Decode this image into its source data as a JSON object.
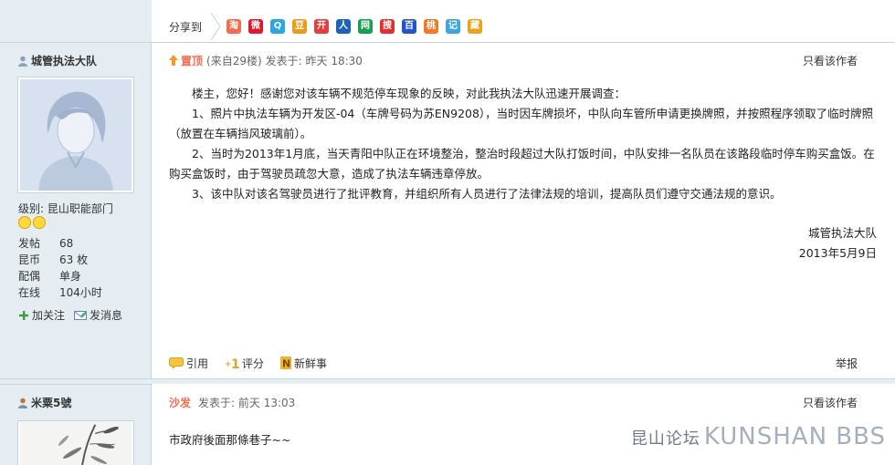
{
  "share": {
    "label": "分享到",
    "icons": [
      {
        "name": "qzone-icon",
        "glyph": "淘",
        "color": "#f26c4f"
      },
      {
        "name": "weibo-icon",
        "glyph": "微",
        "color": "#e6162d"
      },
      {
        "name": "qq-icon",
        "glyph": "Q",
        "color": "#2ba5e4"
      },
      {
        "name": "douban-icon",
        "glyph": "豆",
        "color": "#e89d1a"
      },
      {
        "name": "kaixin-icon",
        "glyph": "开",
        "color": "#e23f3f"
      },
      {
        "name": "renren-icon",
        "glyph": "人",
        "color": "#1e63b8"
      },
      {
        "name": "netease-icon",
        "glyph": "网",
        "color": "#1a9f4f"
      },
      {
        "name": "sohu-icon",
        "glyph": "搜",
        "color": "#e23030"
      },
      {
        "name": "baidu-icon",
        "glyph": "百",
        "color": "#2252cc"
      },
      {
        "name": "peach-icon",
        "glyph": "桃",
        "color": "#f07a2c"
      },
      {
        "name": "note-icon",
        "glyph": "记",
        "color": "#3ea6d8"
      },
      {
        "name": "bookmark-icon",
        "glyph": "藏",
        "color": "#e8a31a"
      }
    ]
  },
  "post1": {
    "author": "城管执法大队",
    "level": "级别: 昆山职能部门",
    "stats": [
      {
        "k": "发帖",
        "v": "68"
      },
      {
        "k": "昆币",
        "v": "63 枚"
      },
      {
        "k": "配偶",
        "v": "单身"
      },
      {
        "k": "在线",
        "v": "104小时"
      }
    ],
    "follow": "加关注",
    "message": "发消息",
    "pin": "置顶",
    "from_floor": "(来自29楼)",
    "posted": "发表于: 昨天 18:30",
    "only_author": "只看该作者",
    "body": [
      "楼主，您好！感谢您对该车辆不规范停车现象的反映，对此我执法大队迅速开展调查：",
      "1、照片中执法车辆为开发区-04（车牌号码为苏EN9208），当时因车牌损坏，中队向车管所申请更换牌照，并按照程序领取了临时牌照（放置在车辆挡风玻璃前）。",
      "2、当时为2013年1月底，当天青阳中队正在环境整治，整治时段超过大队打饭时间，中队安排一名队员在该路段临时停车购买盒饭。在购买盒饭时，由于驾驶员疏忽大意，造成了执法车辆违章停放。",
      "3、该中队对该名驾驶员进行了批评教育，并组织所有人员进行了法律法规的培训，提高队员们遵守交通法规的意识。"
    ],
    "sign_org": "城管执法大队",
    "sign_date": "2013年5月9日",
    "quote": "引用",
    "rate": "评分",
    "fresh": "新鲜事",
    "report": "举报"
  },
  "post2": {
    "author": "米粟5號",
    "sofa": "沙发",
    "posted": "发表于: 前天 13:03",
    "only_author": "只看该作者",
    "body": "市政府後面那條巷子~~"
  },
  "watermark": {
    "small": "昆山论坛",
    "big": "KUNSHAN BBS"
  }
}
